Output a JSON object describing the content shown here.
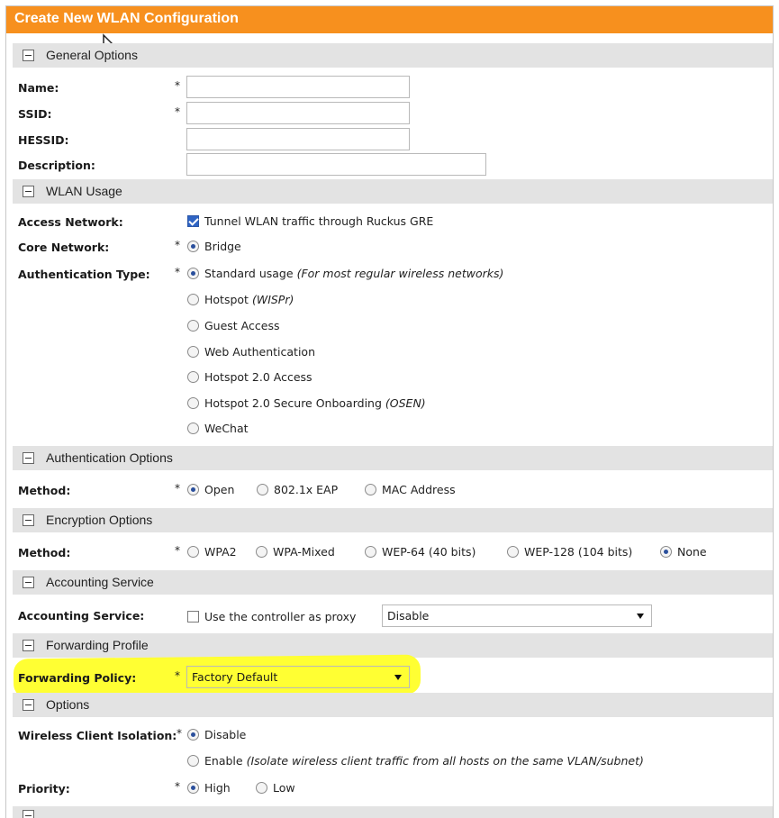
{
  "title": "Create New WLAN Configuration",
  "sections": {
    "general": "General Options",
    "usage": "WLAN Usage",
    "auth": "Authentication Options",
    "encryption": "Encryption Options",
    "accounting": "Accounting Service",
    "forwarding": "Forwarding Profile",
    "options": "Options"
  },
  "general": {
    "name_label": "Name:",
    "ssid_label": "SSID:",
    "hessid_label": "HESSID:",
    "description_label": "Description:",
    "name_value": "",
    "ssid_value": "",
    "hessid_value": "",
    "description_value": ""
  },
  "required_mark": "*",
  "usage": {
    "access_label": "Access Network:",
    "access_option": "Tunnel WLAN traffic through Ruckus GRE",
    "access_checked": true,
    "core_label": "Core Network:",
    "core_option": "Bridge",
    "authtype_label": "Authentication Type:",
    "authtype_options": [
      {
        "label": "Standard usage",
        "note": "(For most regular wireless networks)",
        "selected": true
      },
      {
        "label": "Hotspot",
        "note": "(WISPr)",
        "selected": false
      },
      {
        "label": "Guest Access",
        "note": "",
        "selected": false
      },
      {
        "label": "Web Authentication",
        "note": "",
        "selected": false
      },
      {
        "label": "Hotspot 2.0 Access",
        "note": "",
        "selected": false
      },
      {
        "label": "Hotspot 2.0 Secure Onboarding",
        "note": "(OSEN)",
        "selected": false
      },
      {
        "label": "WeChat",
        "note": "",
        "selected": false
      }
    ]
  },
  "auth": {
    "method_label": "Method:",
    "options": [
      "Open",
      "802.1x EAP",
      "MAC Address"
    ],
    "selected": "Open"
  },
  "encryption": {
    "method_label": "Method:",
    "options": [
      "WPA2",
      "WPA-Mixed",
      "WEP-64 (40 bits)",
      "WEP-128 (104 bits)",
      "None"
    ],
    "selected": "None"
  },
  "accounting": {
    "label": "Accounting Service:",
    "proxy_option": "Use the controller as proxy",
    "proxy_checked": false,
    "select_value": "Disable"
  },
  "forwarding": {
    "label": "Forwarding Policy:",
    "select_value": "Factory Default",
    "highlight_color": "#ffff33"
  },
  "options": {
    "isolation_label": "Wireless Client Isolation:",
    "isolation_disable": "Disable",
    "isolation_enable": "Enable",
    "isolation_enable_note": "(Isolate wireless client traffic from all hosts on the same VLAN/subnet)",
    "isolation_selected": "Disable",
    "priority_label": "Priority:",
    "priority_high": "High",
    "priority_low": "Low",
    "priority_selected": "High"
  },
  "colors": {
    "titlebar": "#f7901e",
    "section_bg": "#e3e3e3",
    "radio_dot": "#2a4f9c",
    "checkbox_on": "#2f64c4"
  }
}
